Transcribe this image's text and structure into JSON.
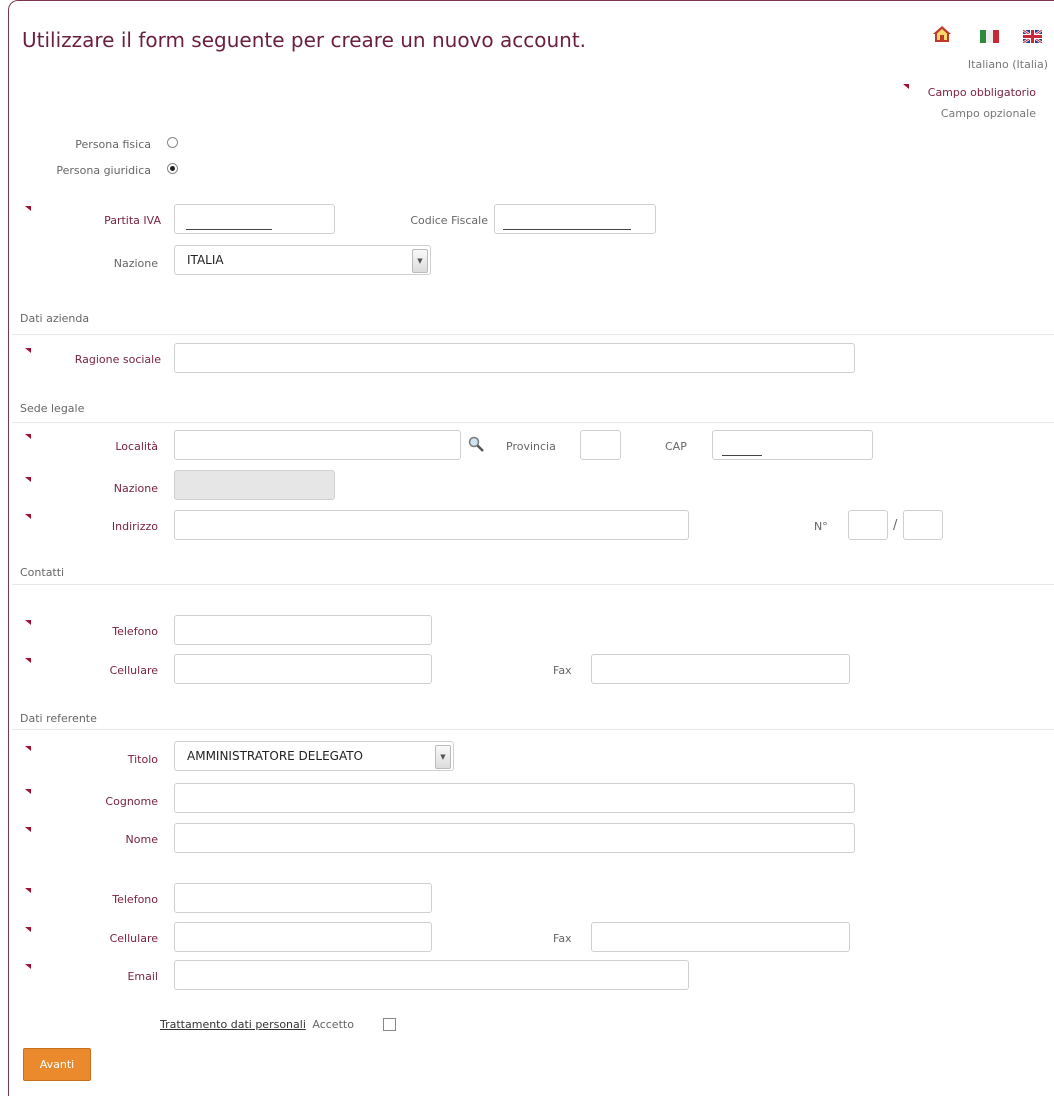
{
  "title": "Utilizzare il form seguente per creare un nuovo account.",
  "header": {
    "language": "Italiano (Italia)",
    "legend_required": "Campo obbligatorio",
    "legend_optional": "Campo opzionale"
  },
  "person_type": {
    "fisica_label": "Persona fisica",
    "giuridica_label": "Persona giuridica",
    "selected": "giuridica"
  },
  "identification": {
    "piva_label": "Partita IVA",
    "codice_fiscale_label": "Codice Fiscale",
    "nazione_label": "Nazione",
    "nazione_value": "ITALIA"
  },
  "azienda": {
    "section": "Dati azienda",
    "ragione_sociale_label": "Ragione sociale"
  },
  "sede": {
    "section": "Sede legale",
    "localita_label": "Località",
    "provincia_label": "Provincia",
    "cap_label": "CAP",
    "nazione_label": "Nazione",
    "indirizzo_label": "Indirizzo",
    "numero_label": "N°",
    "slash": "/"
  },
  "contatti": {
    "section": "Contatti",
    "telefono_label": "Telefono",
    "cellulare_label": "Cellulare",
    "fax_label": "Fax"
  },
  "referente": {
    "section": "Dati referente",
    "titolo_label": "Titolo",
    "titolo_value": "AMMINISTRATORE DELEGATO",
    "cognome_label": "Cognome",
    "nome_label": "Nome",
    "telefono_label": "Telefono",
    "cellulare_label": "Cellulare",
    "fax_label": "Fax",
    "email_label": "Email"
  },
  "privacy": {
    "link_label": "Trattamento dati personali",
    "accept_label": "Accetto"
  },
  "submit_label": "Avanti",
  "colors": {
    "accent": "#6b1f3e",
    "button": "#ea8a2c",
    "required_marker": "#a01030"
  }
}
